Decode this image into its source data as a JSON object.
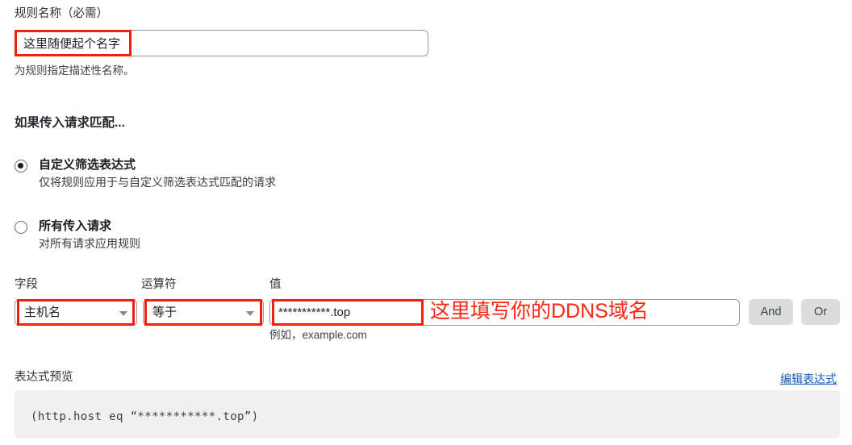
{
  "rule_name": {
    "label": "规则名称（必需）",
    "value": "这里随便起个名字",
    "helper": "为规则指定描述性名称。"
  },
  "match_section": {
    "heading": "如果传入请求匹配...",
    "options": [
      {
        "title": "自定义筛选表达式",
        "description": "仅将规则应用于与自定义筛选表达式匹配的请求",
        "selected": true
      },
      {
        "title": "所有传入请求",
        "description": "对所有请求应用规则",
        "selected": false
      }
    ]
  },
  "condition_row": {
    "field": {
      "label": "字段",
      "value": "主机名"
    },
    "operator": {
      "label": "运算符",
      "value": "等于"
    },
    "value": {
      "label": "值",
      "value": "***********.top",
      "helper": "例如，example.com"
    },
    "and_button": "And",
    "or_button": "Or"
  },
  "annotation": {
    "value_note": "这里填写你的DDNS域名",
    "color": "#fb2512"
  },
  "preview": {
    "label": "表达式预览",
    "edit_link": "编辑表达式",
    "expression": "(http.host eq “***********.top”)"
  }
}
